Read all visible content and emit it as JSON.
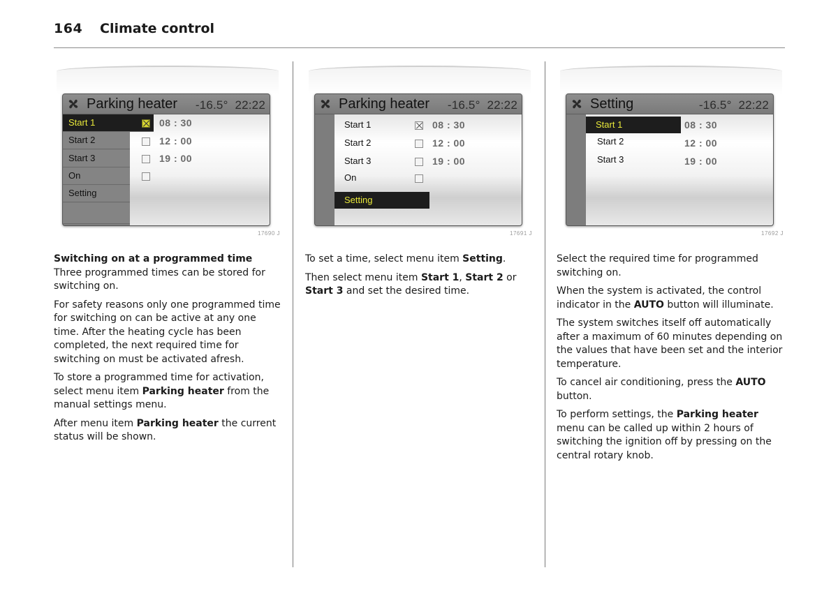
{
  "header": {
    "page_number": "164",
    "section_title": "Climate control"
  },
  "figures": [
    {
      "id": "17690 J",
      "screen": {
        "title": "Parking heater",
        "temperature": "-16.5°",
        "clock": "22:22",
        "menu_items": [
          {
            "label": "Start 1",
            "selected": true,
            "checked": true,
            "time": "08 : 30"
          },
          {
            "label": "Start 2",
            "selected": false,
            "checked": false,
            "time": "12 : 00"
          },
          {
            "label": "Start 3",
            "selected": false,
            "checked": false,
            "time": "19 : 00"
          },
          {
            "label": "On",
            "selected": false,
            "checked": false,
            "time": ""
          },
          {
            "label": "Setting",
            "selected": false,
            "checked": null,
            "time": ""
          }
        ]
      }
    },
    {
      "id": "17691 J",
      "screen": {
        "title": "Parking heater",
        "temperature": "-16.5°",
        "clock": "22:22",
        "menu_items": [
          {
            "label": "Start 1",
            "selected": false,
            "checked": true,
            "time": "08 : 30"
          },
          {
            "label": "Start 2",
            "selected": false,
            "checked": false,
            "time": "12 : 00"
          },
          {
            "label": "Start 3",
            "selected": false,
            "checked": false,
            "time": "19 : 00"
          },
          {
            "label": "On",
            "selected": false,
            "checked": false,
            "time": ""
          },
          {
            "label": "Setting",
            "selected": true,
            "checked": null,
            "time": ""
          }
        ]
      }
    },
    {
      "id": "17692 J",
      "screen": {
        "title": "Setting",
        "temperature": "-16.5°",
        "clock": "22:22",
        "menu_items": [
          {
            "label": "Start 1",
            "selected": true,
            "time": "08 : 30"
          },
          {
            "label": "Start 2",
            "selected": false,
            "time": "12 : 00"
          },
          {
            "label": "Start 3",
            "selected": false,
            "time": "19 : 00"
          }
        ]
      }
    }
  ],
  "columns": [
    {
      "heading": "Switching on at a programmed time",
      "paragraphs": [
        [
          {
            "t": "Three programmed times can be stored for switching on."
          }
        ],
        [
          {
            "t": "For safety reasons only one programmed time for switching on can be active at any one time. After the heating cycle has been completed, the next required time for switching on must be activated afresh."
          }
        ],
        [
          {
            "t": "To store a programmed time for activation, select menu item "
          },
          {
            "t": "Parking heater",
            "b": true
          },
          {
            "t": " from the manual settings menu."
          }
        ],
        [
          {
            "t": "After menu item "
          },
          {
            "t": "Parking heater",
            "b": true
          },
          {
            "t": " the current status will be shown."
          }
        ]
      ]
    },
    {
      "heading": "",
      "paragraphs": [
        [
          {
            "t": "To set a time, select menu item "
          },
          {
            "t": "Setting",
            "b": true
          },
          {
            "t": "."
          }
        ],
        [
          {
            "t": "Then select menu item "
          },
          {
            "t": "Start 1",
            "b": true
          },
          {
            "t": ", "
          },
          {
            "t": "Start 2",
            "b": true
          },
          {
            "t": " or "
          },
          {
            "t": "Start 3",
            "b": true
          },
          {
            "t": " and set the desired time."
          }
        ]
      ]
    },
    {
      "heading": "",
      "paragraphs": [
        [
          {
            "t": "Select the required time for programmed switching on."
          }
        ],
        [
          {
            "t": "When the system is activated, the control indicator in the "
          },
          {
            "t": "AUTO",
            "b": true
          },
          {
            "t": " button will illuminate."
          }
        ],
        [
          {
            "t": "The system switches itself off automatically after a maximum of 60 minutes depending on the values that have been set and the interior temperature."
          }
        ],
        [
          {
            "t": "To cancel air conditioning, press the "
          },
          {
            "t": "AUTO",
            "b": true
          },
          {
            "t": " button."
          }
        ],
        [
          {
            "t": "To perform settings, the "
          },
          {
            "t": "Parking heater",
            "b": true
          },
          {
            "t": " menu can be called up within 2 hours of switching the ignition off by pressing on the central rotary knob."
          }
        ]
      ]
    }
  ],
  "colors": {
    "highlight_text": "#e8e83a",
    "highlight_bg": "#1d1d1d",
    "screen_frame": "#7b7b7b"
  }
}
